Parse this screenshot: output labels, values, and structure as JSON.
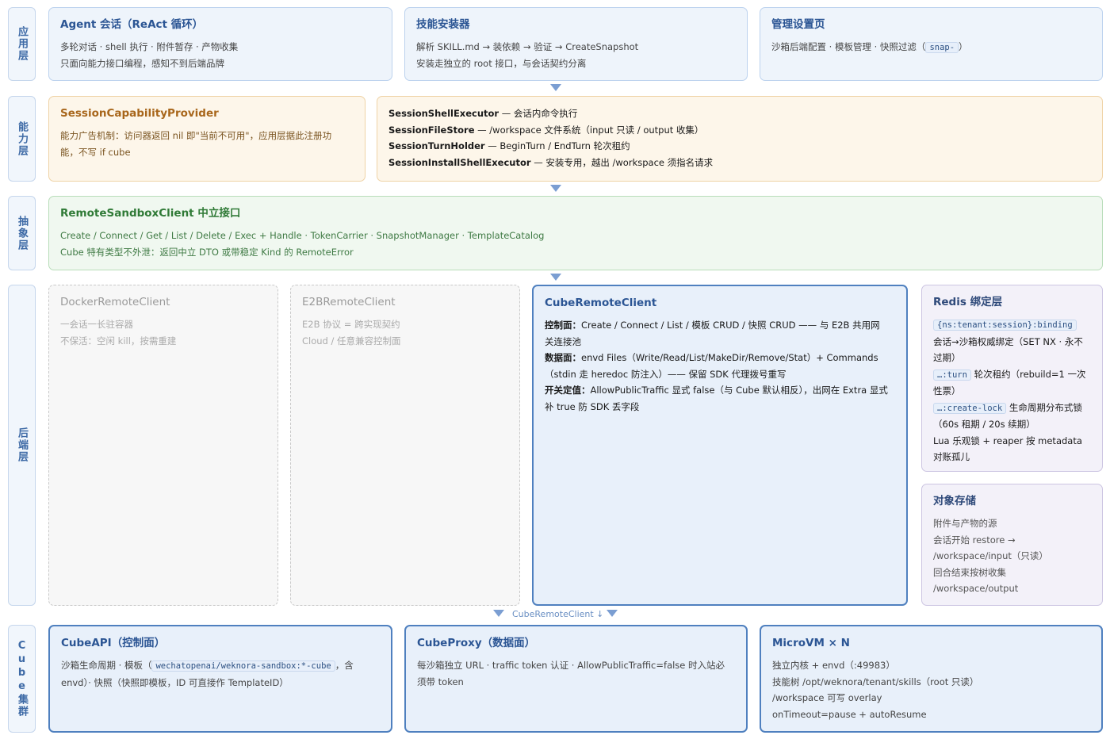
{
  "layers": {
    "app": "应用层",
    "capability": "能力层",
    "abstraction": "抽象层",
    "backend": "后端层",
    "cube_cluster": "Cube集群"
  },
  "app": {
    "agent": {
      "title": "Agent 会话（ReAct 循环）",
      "line1": "多轮对话 · shell 执行 · 附件暂存 · 产物收集",
      "line2": "只面向能力接口编程，感知不到后端品牌"
    },
    "installer": {
      "title": "技能安装器",
      "line1": "解析 SKILL.md → 装依赖 → 验证 → CreateSnapshot",
      "line2": "安装走独立的 root 接口，与会话契约分离"
    },
    "settings": {
      "title": "管理设置页",
      "line1_pre": "沙箱后端配置 · 模板管理 · 快照过滤（",
      "line1_code": "snap-",
      "line1_post": "）"
    }
  },
  "capability": {
    "provider": {
      "title": "SessionCapabilityProvider",
      "line1": "能力广告机制：访问器返回 nil 即\"当前不可用\"，应用层据此注册功",
      "line2": "能，不写 if cube"
    },
    "executors": [
      {
        "name": "SessionShellExecutor",
        "desc": " — 会话内命令执行"
      },
      {
        "name": "SessionFileStore",
        "desc": " — /workspace 文件系统（input 只读 / output 收集）"
      },
      {
        "name": "SessionTurnHolder",
        "desc": " — BeginTurn / EndTurn 轮次租约"
      },
      {
        "name": "SessionInstallShellExecutor",
        "desc": " — 安装专用，越出 /workspace 须指名请求"
      }
    ]
  },
  "abstraction": {
    "title": "RemoteSandboxClient 中立接口",
    "line1": "Create / Connect / Get / List / Delete / Exec + Handle · TokenCarrier · SnapshotManager · TemplateCatalog",
    "line2": "Cube 特有类型不外泄：返回中立 DTO 或带稳定 Kind 的 RemoteError"
  },
  "backend": {
    "docker": {
      "title": "DockerRemoteClient",
      "line1": "一会话一长驻容器",
      "line2": "不保活：空闲 kill，按需重建"
    },
    "e2b": {
      "title": "E2BRemoteClient",
      "line1": "E2B 协议 = 跨实现契约",
      "line2": "Cloud / 任意兼容控制面"
    },
    "cube": {
      "title": "CubeRemoteClient",
      "control_label": "控制面：",
      "control_text": "Create / Connect / List / 模板 CRUD / 快照 CRUD —— 与 E2B 共用网关连接池",
      "data_label": "数据面：",
      "data_text": "envd Files（Write/Read/List/MakeDir/Remove/Stat）+ Commands（stdin 走 heredoc 防注入）—— 保留 SDK 代理拨号重写",
      "switch_label": "开关定值：",
      "switch_text": "AllowPublicTraffic 显式 false（与 Cube 默认相反），出网在 Extra 显式补 true 防 SDK 丢字段"
    },
    "redis": {
      "title": "Redis 绑定层",
      "code1": "{ns:tenant:session}:binding",
      "text1": "会话→沙箱权威绑定（SET NX · 永不过期）",
      "code2": "…:turn",
      "text2": " 轮次租约（rebuild=1 一次性票）",
      "code3": "…:create-lock",
      "text3": " 生命周期分布式锁（60s 租期 / 20s 续期）",
      "text4": "Lua 乐观锁 + reaper 按 metadata 对账孤儿"
    },
    "storage": {
      "title": "对象存储",
      "lines": [
        "附件与产物的源",
        "会话开始 restore →",
        "/workspace/input（只读）",
        "回合结束按树收集",
        "/workspace/output"
      ]
    }
  },
  "connector_label": "CubeRemoteClient ↓",
  "cluster": {
    "api": {
      "title": "CubeAPI（控制面）",
      "line1_pre": "沙箱生命周期 · 模板（",
      "line1_code": "wechatopenai/weknora-sandbox:*-cube",
      "line1_post": "，含",
      "line2": "envd）· 快照（快照即模板，ID 可直接作 TemplateID）"
    },
    "proxy": {
      "title": "CubeProxy（数据面）",
      "line1": "每沙箱独立 URL · traffic token 认证 · AllowPublicTraffic=false 时入站必",
      "line2": "须带 token"
    },
    "microvm": {
      "title": "MicroVM × N",
      "lines": [
        "独立内核 + envd（:49983）",
        "技能树 /opt/weknora/tenant/skills（root 只读）",
        "/workspace 可写 overlay",
        "onTimeout=pause + autoResume"
      ]
    }
  }
}
